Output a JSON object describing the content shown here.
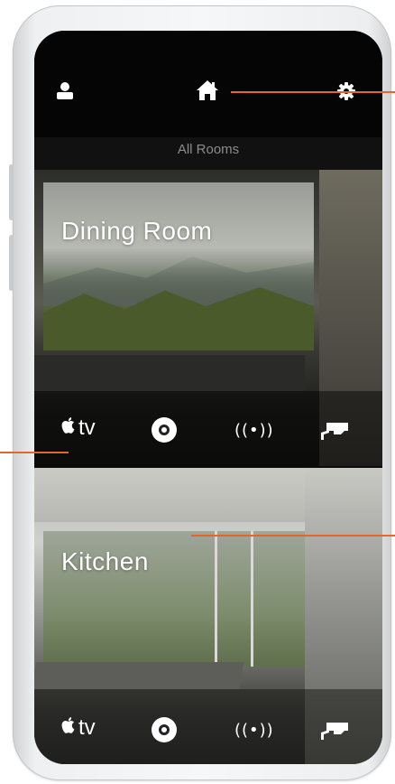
{
  "header": {
    "rooms_label": "All Rooms"
  },
  "icons": {
    "profile": "person-icon",
    "home": "home-icon",
    "settings": "gear-icon"
  },
  "rooms": [
    {
      "name": "Dining Room",
      "controls": {
        "apple_tv": "tv",
        "music": "disc-icon",
        "wireless": "((•))",
        "camera": "camera-icon"
      }
    },
    {
      "name": "Kitchen",
      "controls": {
        "apple_tv": "tv",
        "music": "disc-icon",
        "wireless": "((•))",
        "camera": "camera-icon"
      }
    }
  ],
  "colors": {
    "accent": "#e8652a",
    "topbar": "#050505"
  }
}
